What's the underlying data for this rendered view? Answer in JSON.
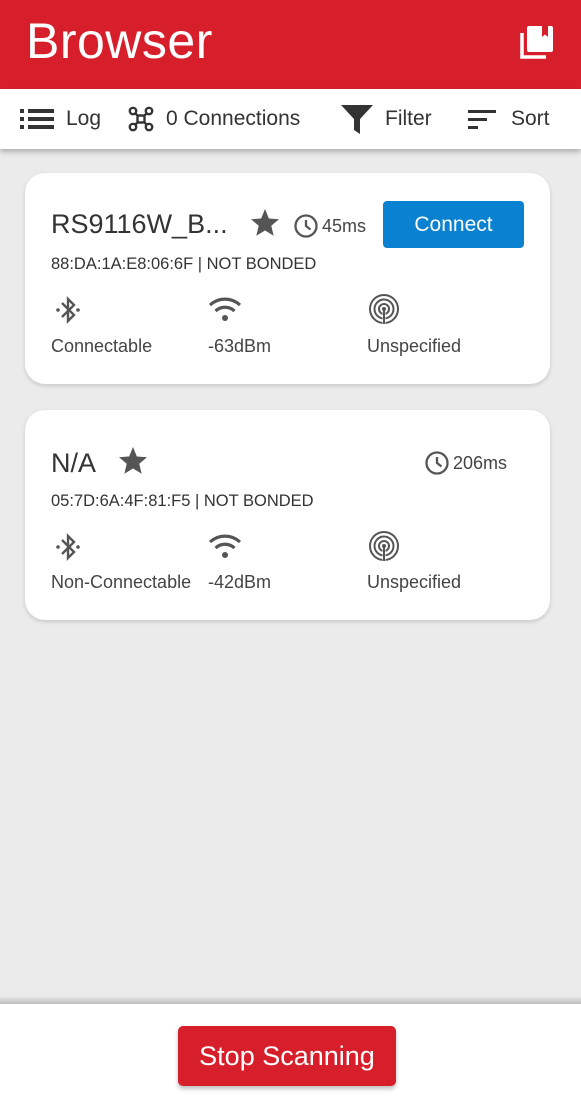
{
  "app_bar": {
    "title": "Browser",
    "action_icon": "bookmarks-icon"
  },
  "toolbar": {
    "log": {
      "label": "Log",
      "icon": "list-icon"
    },
    "connections": {
      "label": "0 Connections",
      "icon": "connections-icon"
    },
    "filter": {
      "label": "Filter",
      "icon": "filter-icon"
    },
    "sort": {
      "label": "Sort",
      "icon": "sort-icon"
    }
  },
  "devices": [
    {
      "name": "RS9116W_B...",
      "favorite_icon": "star-icon",
      "interval": "45ms",
      "connect_label": "Connect",
      "address_line": "88:DA:1A:E8:06:6F | NOT BONDED",
      "connectable": "Connectable",
      "rssi": "-63dBm",
      "beacon": "Unspecified"
    },
    {
      "name": "N/A",
      "favorite_icon": "star-icon",
      "interval": "206ms",
      "address_line": "05:7D:6A:4F:81:F5 | NOT BONDED",
      "connectable": "Non-Connectable",
      "rssi": "-42dBm",
      "beacon": "Unspecified"
    }
  ],
  "footer": {
    "stop_label": "Stop Scanning"
  },
  "colors": {
    "brand_red": "#d71f2b",
    "connect_blue": "#0a81d1"
  }
}
